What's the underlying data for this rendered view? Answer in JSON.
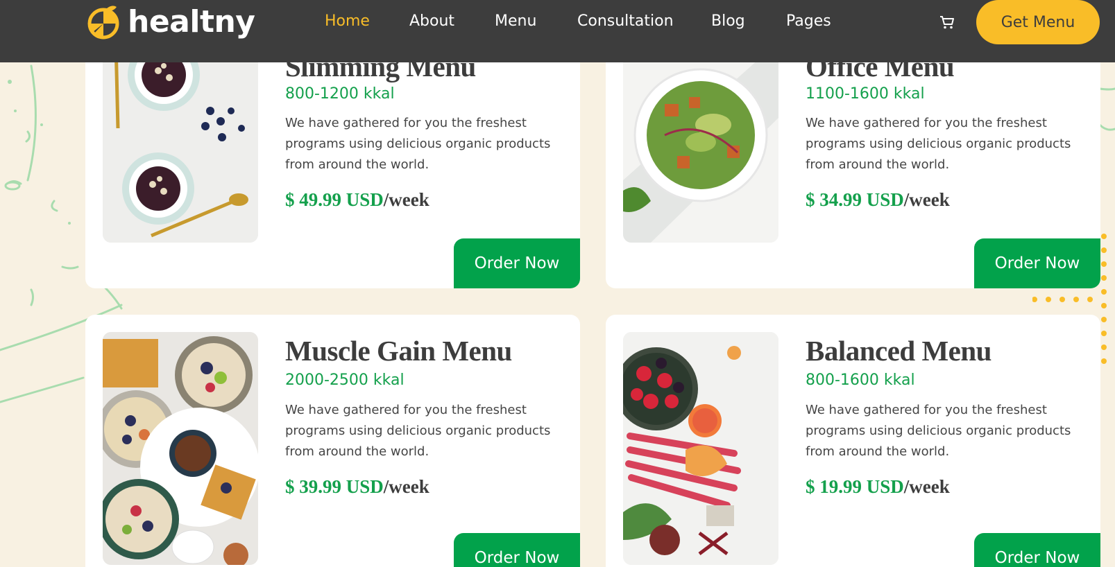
{
  "brand": {
    "name": "healtny"
  },
  "nav": {
    "items": [
      {
        "label": "Home",
        "active": true
      },
      {
        "label": "About",
        "active": false
      },
      {
        "label": "Menu",
        "active": false
      },
      {
        "label": "Consultation",
        "active": false
      },
      {
        "label": "Blog",
        "active": false
      },
      {
        "label": "Pages",
        "active": false
      }
    ],
    "cart_icon": "shopping-cart-icon",
    "cta_label": "Get Menu"
  },
  "colors": {
    "header_bg": "#3d3d3d",
    "accent_yellow": "#f9bd28",
    "accent_green": "#14a04c",
    "button_green": "#02a24b",
    "page_bg": "#f8f1e2"
  },
  "cards": [
    {
      "title": "Slimming Menu",
      "kcal": "800-1200 kkal",
      "description": "We have gathered for you the freshest programs using delicious organic products from around the world.",
      "price_amount": "$ 49.99 USD",
      "price_unit": "/week",
      "button_label": "Order Now",
      "photo": "yogurt-bowls-photo"
    },
    {
      "title": "Office Menu",
      "kcal": "1100-1600 kkal",
      "description": "We have gathered for you the freshest programs using delicious organic products from around the world.",
      "price_amount": "$ 34.99 USD",
      "price_unit": "/week",
      "button_label": "Order Now",
      "photo": "salad-bowl-photo"
    },
    {
      "title": "Muscle Gain Menu",
      "kcal": "2000-2500 kkal",
      "description": "We have gathered for you the freshest programs using delicious organic products from around the world.",
      "price_amount": "$ 39.99 USD",
      "price_unit": "/week",
      "button_label": "Order Now",
      "photo": "breakfast-spread-photo"
    },
    {
      "title": "Balanced Menu",
      "kcal": "800-1600 kkal",
      "description": "We have gathered for you the freshest programs using delicious organic products from around the world.",
      "price_amount": "$ 19.99 USD",
      "price_unit": "/week",
      "button_label": "Order Now",
      "photo": "fruit-vegetables-photo"
    }
  ]
}
